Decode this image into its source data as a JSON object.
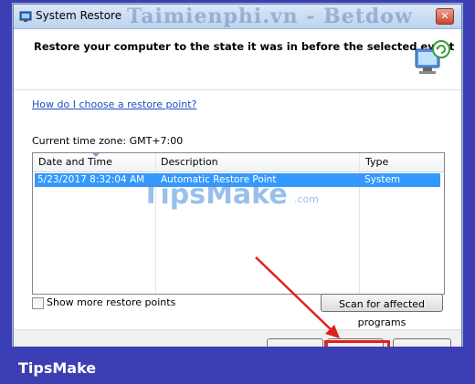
{
  "window": {
    "title": "System Restore",
    "close_glyph": "✕"
  },
  "watermarks": {
    "top": "Taimienphi.vn - Betdow",
    "middle": "TipsMake",
    "middle_suffix": ".com"
  },
  "header": {
    "text": "Restore your computer to the state it was in before the selected event",
    "icon": "system-restore-monitor-icon"
  },
  "help_link": "How do I choose a restore point?",
  "timezone": "Current time zone: GMT+7:00",
  "list": {
    "columns": [
      "Date and Time",
      "Description",
      "Type"
    ],
    "rows": [
      {
        "date": "5/23/2017 8:32:04 AM",
        "description": "Automatic Restore Point",
        "type": "System"
      }
    ]
  },
  "show_more_label": "Show more restore points",
  "scan_button": "Scan for affected programs",
  "footer": {
    "brand": "TipsMake"
  },
  "colors": {
    "background": "#3b3fb3",
    "selection": "#3399ff",
    "highlight": "#e02020"
  }
}
